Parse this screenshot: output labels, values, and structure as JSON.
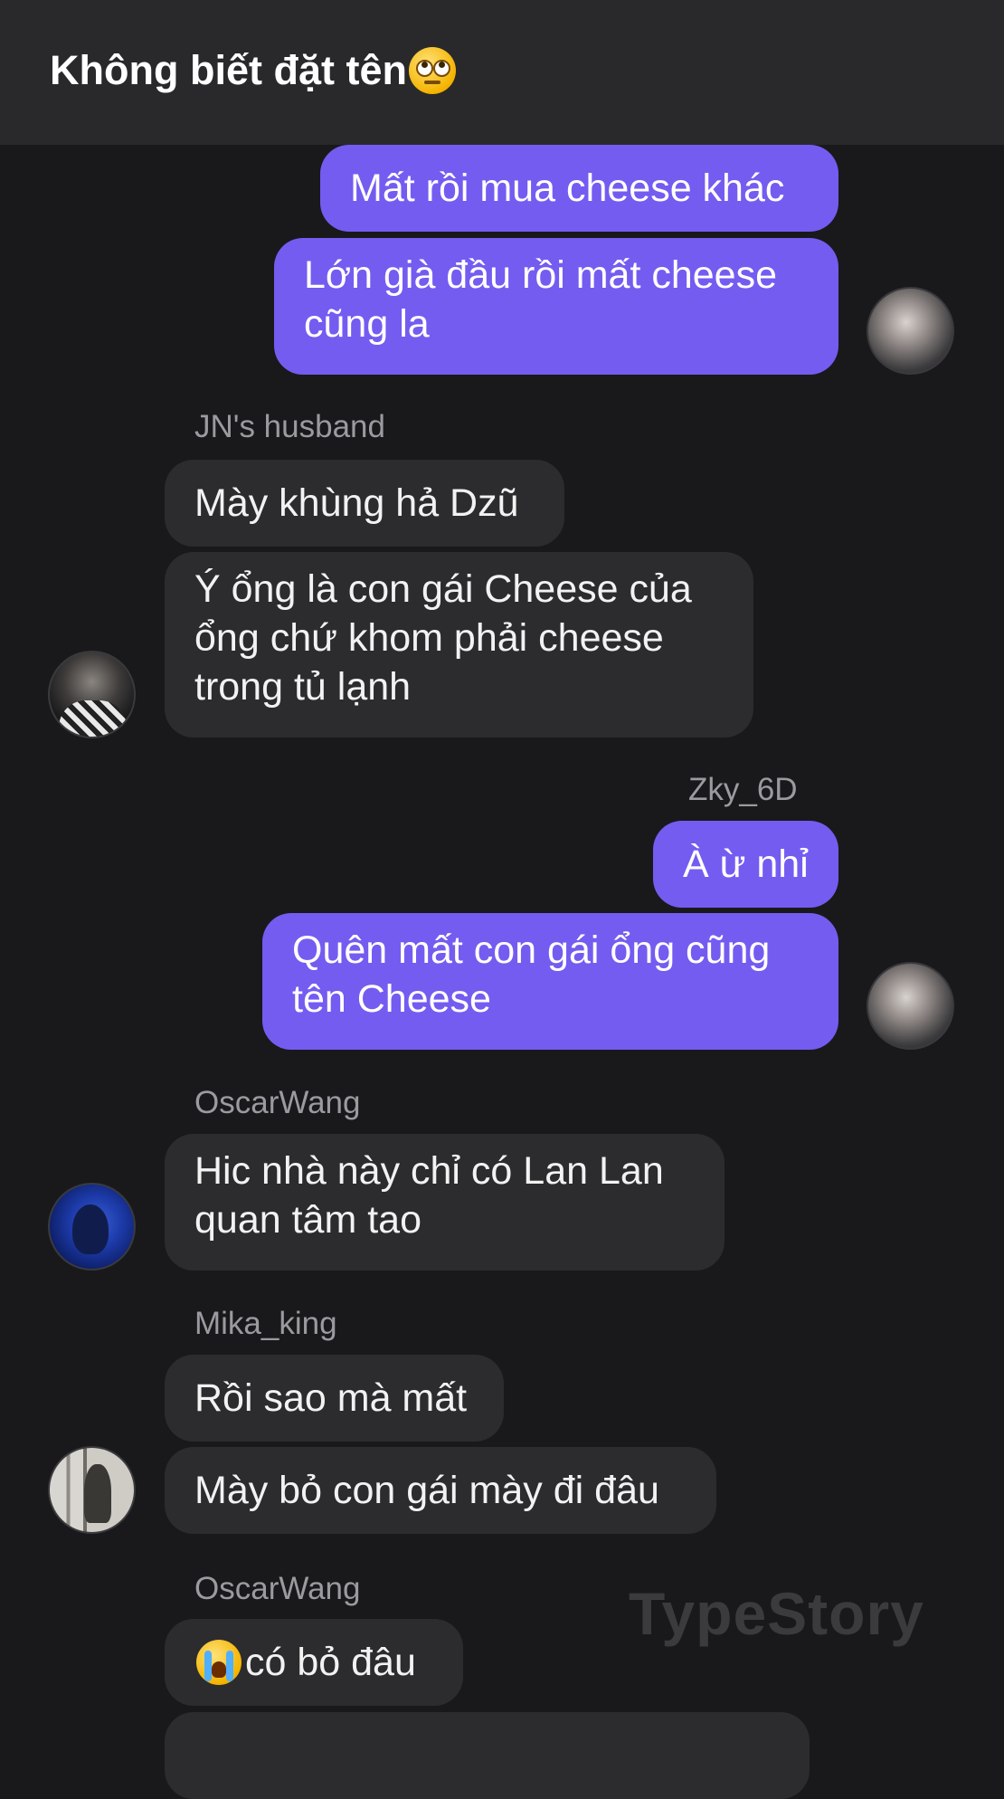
{
  "header": {
    "title": "Không biết đặt tên",
    "title_emoji": "face-with-rolling-eyes"
  },
  "messages": {
    "m1": "Mất rồi mua cheese khác",
    "m2": "Lớn già đầu rồi mất cheese cũng la",
    "s1": "JN's husband",
    "m3": "Mày khùng hả Dzũ",
    "m4": "Ý ổng là con gái Cheese của ổng chứ khom phải cheese trong tủ lạnh",
    "s2": "Zky_6D",
    "m5": "À ừ nhỉ",
    "m6": "Quên mất con gái ổng cũng tên Cheese",
    "s3": "OscarWang",
    "m7": "Hic nhà này chỉ có Lan Lan quan tâm tao",
    "s4": "Mika_king",
    "m8": "Rồi sao mà mất",
    "m9": "Mày bỏ con gái mày đi đâu",
    "s5": "OscarWang",
    "m10": "có bỏ đâu",
    "m10_emoji": "loudly-crying-face"
  },
  "watermark": "TypeStory",
  "colors": {
    "outgoing_bubble": "#745cf1",
    "incoming_bubble": "#2c2c2f",
    "background": "#19191b",
    "header": "#29292b"
  }
}
